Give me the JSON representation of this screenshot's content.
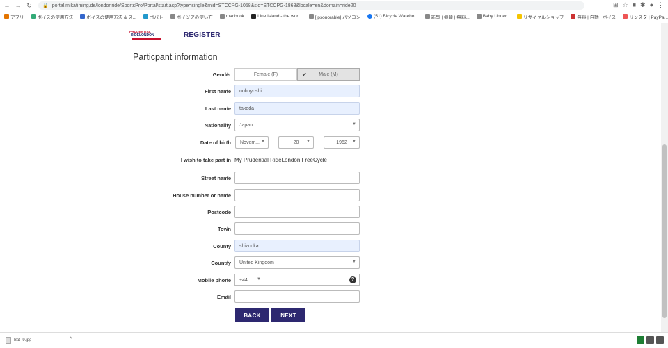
{
  "browser": {
    "url": "portal.mikatiming.de/londonride/SportsPro/Portal/start.asp?type=single&mid=STCCPG-1058&sid=STCCPG-1868&locale=en&domain=ride20",
    "bookmarks": [
      "アプリ",
      "ボイスの使用方法",
      "ボイスの使用方法 & ス...",
      "ゴパト",
      "ボイジアの使い方",
      "macbook",
      "Line Island - the wor...",
      "[Ipsonorable] パソコン",
      "(51) Bicycle Wareho...",
      "新型 | 機能 | 無料...",
      "Baby Under...",
      "リサイクルショップ",
      "無料 | 自動 | ボイス",
      "リンスタ | PayPa..."
    ]
  },
  "header": {
    "logo_line1": "PRUDENTIAL",
    "logo_line2": "RIDELONDON",
    "title": "REGISTER"
  },
  "form": {
    "section_title": "Particpant information",
    "gender": {
      "label": "Gender",
      "female": "Female (F)",
      "male": "Male (M)"
    },
    "first_name": {
      "label": "First name",
      "value": "nobuyoshi"
    },
    "last_name": {
      "label": "Last name",
      "value": "takeda"
    },
    "nationality": {
      "label": "Nationality",
      "value": "Japan"
    },
    "dob": {
      "label": "Date of birth",
      "month": "Novem...",
      "day": "20",
      "year": "1962"
    },
    "take_part": {
      "label": "I wish to take part in",
      "value": "My Prudential RideLondon FreeCycle"
    },
    "street": {
      "label": "Street name"
    },
    "house": {
      "label": "House number or name"
    },
    "postcode": {
      "label": "Postcode"
    },
    "town": {
      "label": "Town"
    },
    "county": {
      "label": "County",
      "value": "shizuoka"
    },
    "country": {
      "label": "Country",
      "value": "United Kingdom"
    },
    "mobile": {
      "label": "Mobile phone",
      "code": "+44"
    },
    "email": {
      "label": "Email"
    },
    "required_mark": "•"
  },
  "buttons": {
    "back": "BACK",
    "next": "NEXT"
  },
  "downloads": {
    "file": "Bat_9.jpg"
  }
}
